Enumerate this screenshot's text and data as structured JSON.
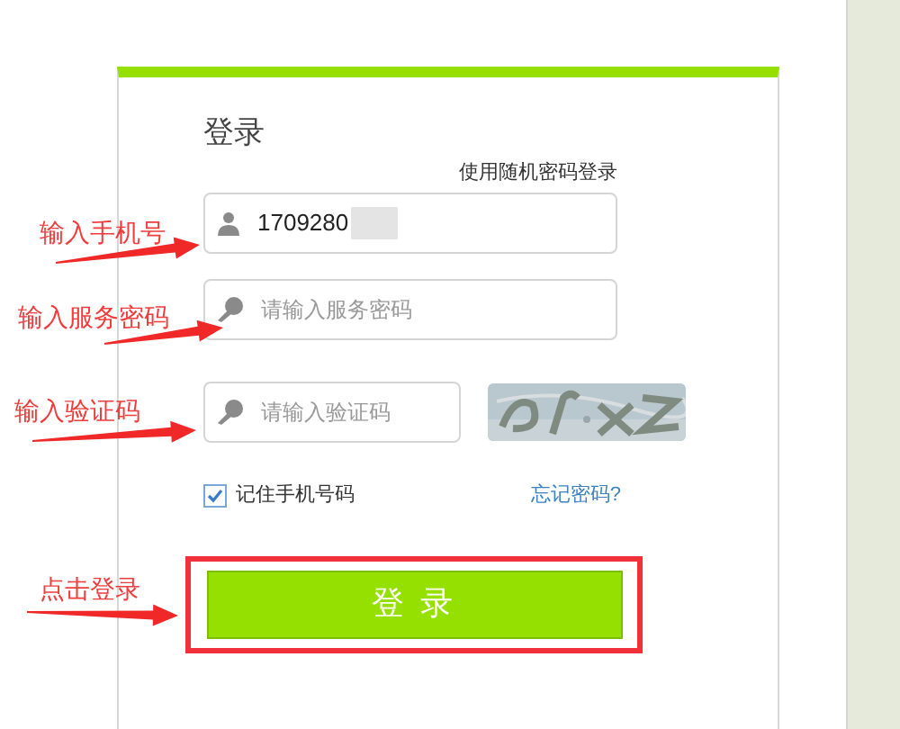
{
  "title": "登录",
  "alt_login_link": "使用随机密码登录",
  "phone_field": {
    "value": "1709280"
  },
  "password_field": {
    "placeholder": "请输入服务密码"
  },
  "captcha_field": {
    "placeholder": "请输入验证码"
  },
  "remember": {
    "label": "记住手机号码",
    "checked": true
  },
  "forgot_link": "忘记密码?",
  "login_button": {
    "label": "登 录",
    "highlighted": true
  },
  "annotations": [
    {
      "text": "输入手机号"
    },
    {
      "text": "输入服务密码"
    },
    {
      "text": "输入验证码"
    },
    {
      "text": "点击登录"
    }
  ]
}
